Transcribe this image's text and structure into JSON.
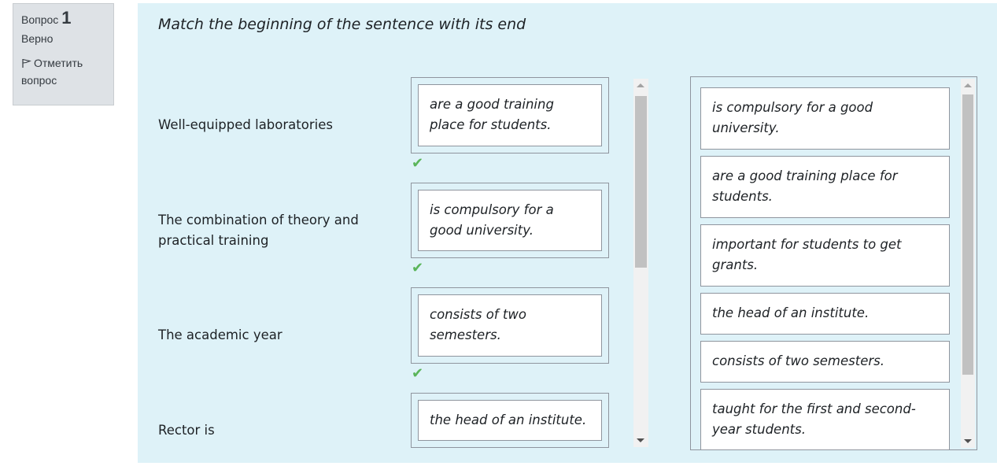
{
  "info": {
    "question_label": "Вопрос",
    "question_number": "1",
    "state": "Верно",
    "flag_label": "Отметить вопрос"
  },
  "question_text": "Match the beginning of the sentence with its end",
  "rows": [
    {
      "stem": "Well-equipped laboratories",
      "answer": "are a good training place for students."
    },
    {
      "stem": "The combination of theory and practical training",
      "answer": "is compulsory for a good university."
    },
    {
      "stem": "The academic year",
      "answer": "consists of two semesters."
    },
    {
      "stem": "Rector is",
      "answer": "the head of an institute."
    }
  ],
  "choices": [
    "is compulsory for a good university.",
    "are a good training place for students.",
    "important for students to get grants.",
    "the head of an institute.",
    "consists of two semesters.",
    "taught for the first and second-year students."
  ],
  "colors": {
    "content_bg": "#def2f8",
    "info_bg": "#dee2e6",
    "check": "#5ab55a"
  },
  "icons": {
    "flag": "flag-icon",
    "check": "check-icon"
  }
}
